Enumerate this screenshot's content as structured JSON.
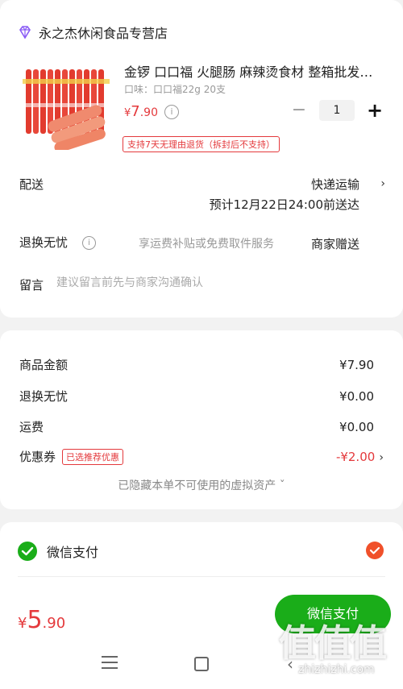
{
  "store": {
    "name": "永之杰休闲食品专营店",
    "icon": "store-diamond-icon"
  },
  "product": {
    "title": "金锣 口口福 火腿肠 麻辣烫食材 整箱批发…",
    "spec": "口味：口口福22g 20支",
    "price_symbol": "¥",
    "price_int": "7",
    "price_dec": ".90",
    "quantity": "1",
    "return_policy": "支持7天无理由退货（拆封后不支持）"
  },
  "delivery": {
    "label": "配送",
    "method": "快递运输",
    "eta": "预计12月22日24:00前送达"
  },
  "returns": {
    "label": "退换无忧",
    "service": "享运费补贴或免费取件服务",
    "gift": "商家赠送"
  },
  "note": {
    "label": "留言",
    "placeholder": "建议留言前先与商家沟通确认"
  },
  "summary": {
    "rows": [
      {
        "label": "商品金额",
        "value": "¥7.90"
      },
      {
        "label": "退换无忧",
        "value": "¥0.00"
      },
      {
        "label": "运费",
        "value": "¥0.00"
      }
    ],
    "coupon": {
      "label": "优惠券",
      "tag": "已选推荐优惠",
      "value": "-¥2.00"
    },
    "hidden_assets": "已隐藏本单不可使用的虚拟资产 ˇ"
  },
  "payment": {
    "method": "微信支付",
    "selected": true,
    "accent": "#f0502a"
  },
  "footer": {
    "total_symbol": "¥",
    "total_int": "5",
    "total_dec": ".90",
    "pay_button": "微信支付",
    "button_color": "#1aad19"
  },
  "watermark": {
    "text": "值值值",
    "url": "zhizhizhi.com"
  }
}
